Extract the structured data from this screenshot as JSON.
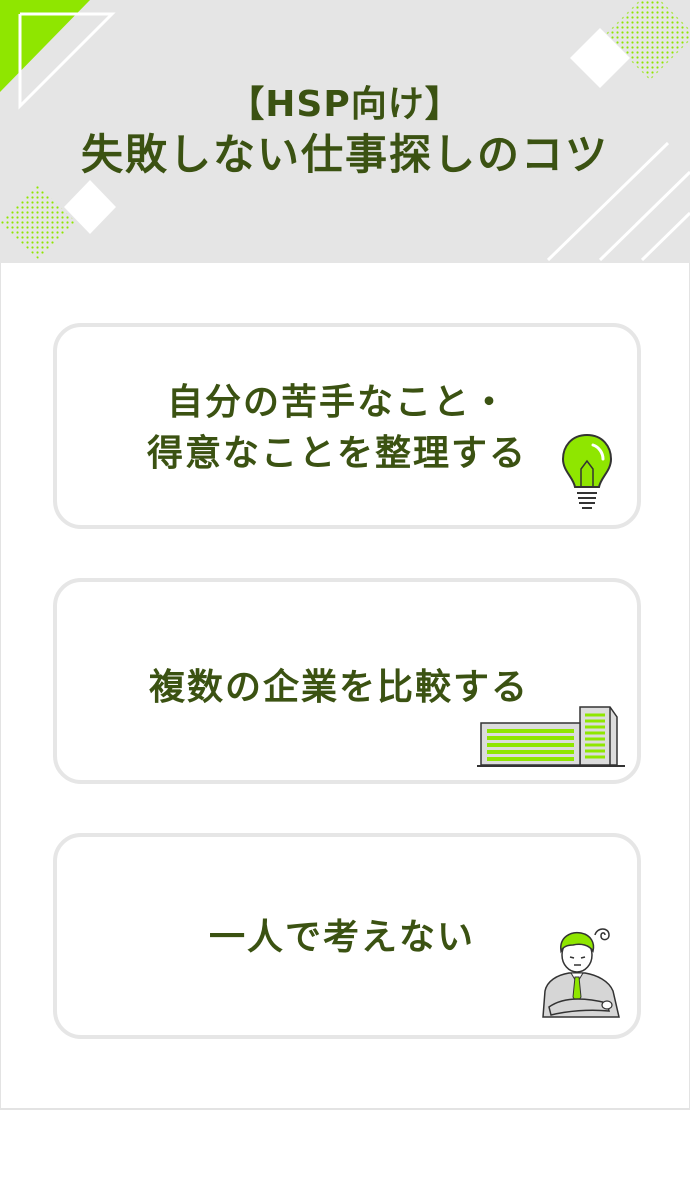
{
  "header": {
    "title_line1": "【HSP向け】",
    "title_line2": "失敗しない仕事探しのコツ"
  },
  "tips": [
    {
      "line1": "自分の苦手なこと・",
      "line2": "得意なことを整理する",
      "icon": "lightbulb-icon"
    },
    {
      "line1": "複数の企業を比較する",
      "icon": "office-building-icon"
    },
    {
      "line1": "一人で考えない",
      "icon": "worried-businessman-icon"
    }
  ],
  "colors": {
    "accent_green": "#8fe600",
    "text_dark_green": "#3b5212",
    "header_bg": "#e5e5e5",
    "card_border": "#e6e6e6"
  }
}
